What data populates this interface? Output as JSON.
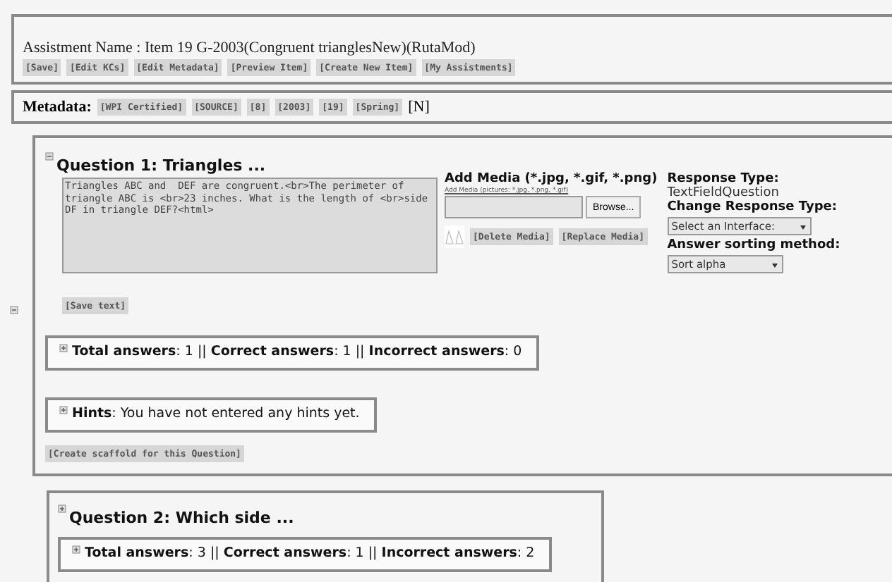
{
  "assistment": {
    "name": "Assistment Name : Item 19 G-2003(Congruent trianglesNew)(RutaMod)",
    "buttons": [
      "[Save]",
      "[Edit KCs]",
      "[Edit Metadata]",
      "[Preview Item]",
      "[Create New Item]",
      "[My Assistments]"
    ]
  },
  "metadata": {
    "label": "Metadata:",
    "tags": [
      "[WPI Certified]",
      "[SOURCE]",
      "[8]",
      "[2003]",
      "[19]",
      "[Spring]"
    ],
    "trailing": "[N]"
  },
  "questions": [
    {
      "title": "Question 1: Triangles ...",
      "expanded": true,
      "text": "Triangles ABC and  DEF are congruent.<br>The perimeter of triangle ABC is <br>23 inches. What is the length of <br>side DF in triangle DEF?<html>",
      "save_button": "[Save text]",
      "media": {
        "heading": "Add Media (*.jpg, *.gif, *.png)",
        "hint": "Add Media (pictures: *.jpg, *.png, *.gif)",
        "browse": "Browse...",
        "buttons": [
          "[Delete Media]",
          "[Replace Media]"
        ]
      },
      "response": {
        "type_label": "Response Type:",
        "type_value": "TextFieldQuestion",
        "change_label": "Change Response Type:",
        "interface_select": "Select an Interface:",
        "sort_label": "Answer sorting method:",
        "sort_select": "Sort alpha"
      },
      "stats": {
        "expanded": false,
        "text": "**Total answers**: 1 || **Correct answers**: 1 || **Incorrect answers**: 0"
      },
      "hints": {
        "expanded": false,
        "text": "**Hints**: You have not entered any hints yet."
      },
      "scaffold_button": "[Create scaffold for this Question]"
    },
    {
      "title": "Question 2: Which side ...",
      "expanded": false,
      "stats": {
        "expanded": false,
        "text": "**Total answers**: 3 || **Correct answers**: 1 || **Incorrect answers**: 2"
      }
    }
  ]
}
